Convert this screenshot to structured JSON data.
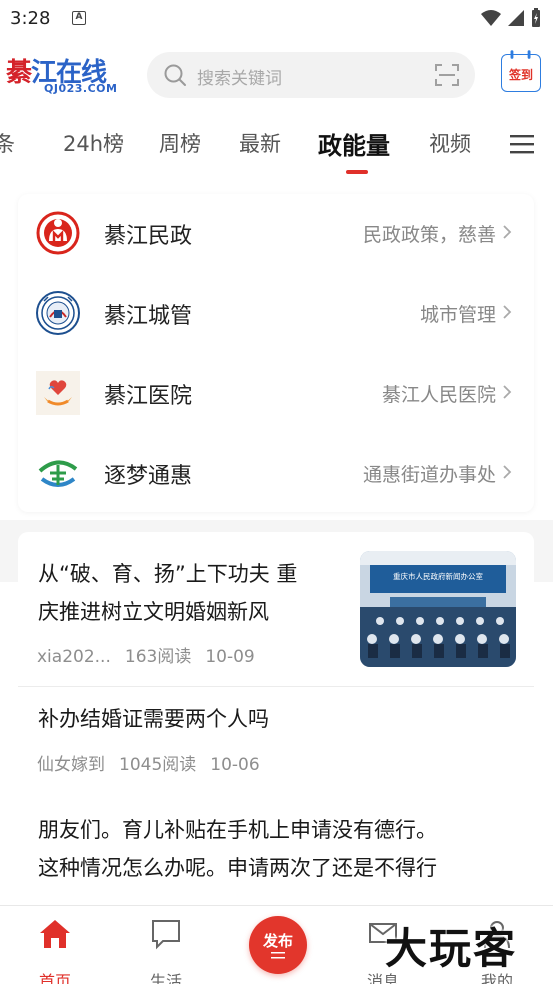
{
  "status_bar": {
    "time": "3:28",
    "notification_letter": "A"
  },
  "header": {
    "logo_text": "綦江在线",
    "logo_text_first": "綦",
    "logo_text_rest": "江在线",
    "logo_sub": "QJ023.COM",
    "search_placeholder": "搜索关键词",
    "checkin_label": "签到"
  },
  "tabs": [
    {
      "label": "头条",
      "visible_text": "条"
    },
    {
      "label": "24h榜"
    },
    {
      "label": "周榜"
    },
    {
      "label": "最新"
    },
    {
      "label": "政能量",
      "active": true
    },
    {
      "label": "视频"
    }
  ],
  "gov_accounts": [
    {
      "name": "綦江民政",
      "desc": "民政政策，慈善",
      "icon": "civil-affairs-logo"
    },
    {
      "name": "綦江城管",
      "desc": "城市管理",
      "icon": "urban-management-emblem"
    },
    {
      "name": "綦江医院",
      "desc": "綦江人民医院",
      "icon": "hospital-heart-logo"
    },
    {
      "name": "逐梦通惠",
      "desc": "通惠街道办事处",
      "icon": "tonghui-logo"
    }
  ],
  "articles": [
    {
      "title_line1": "从“破、育、扬”上下功夫 重",
      "title_line2": "庆推进树立文明婚姻新风",
      "author": "xia202...",
      "reads": "163阅读",
      "date": "10-09",
      "thumb_banner": "重庆市人民政府新闻办公室"
    },
    {
      "title_line1": "补办结婚证需要两个人吗",
      "author": "仙女嫁到",
      "reads": "1045阅读",
      "date": "10-06"
    },
    {
      "title_line1": "朋友们。育儿补贴在手机上申请没有德行。",
      "title_line2": "这种情况怎么办呢。申请两次了还是不得行"
    }
  ],
  "bottom_nav": {
    "home": "首页",
    "life": "生活",
    "publish": "发布",
    "messages": "消息",
    "mine": "我的"
  },
  "watermark": "大玩客",
  "colors": {
    "accent": "#e0302a",
    "brand_blue": "#2b63c7",
    "text_muted": "#888888"
  }
}
